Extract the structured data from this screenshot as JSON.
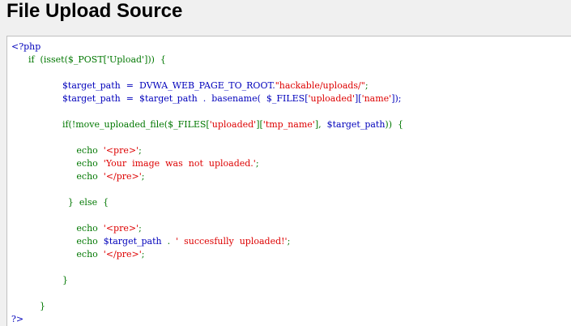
{
  "page": {
    "title": "File Upload Source"
  },
  "source": {
    "lines": [
      [
        {
          "t": "<?php",
          "c": "tag"
        }
      ],
      [
        {
          "t": "      if  (isset($_POST['Upload']))  {",
          "c": "kw"
        }
      ],
      [
        {
          "t": "",
          "c": "kw"
        }
      ],
      [
        {
          "t": "                  $target_path  =  DVWA_WEB_PAGE_TO_ROOT.",
          "c": "var"
        },
        {
          "t": "\"hackable/uploads/\"",
          "c": "str"
        },
        {
          "t": ";",
          "c": "kw"
        }
      ],
      [
        {
          "t": "                  $target_path  =  $target_path  .  basename(  $_FILES[",
          "c": "var"
        },
        {
          "t": "'uploaded'",
          "c": "str"
        },
        {
          "t": "][",
          "c": "var"
        },
        {
          "t": "'name'",
          "c": "str"
        },
        {
          "t": "]);",
          "c": "var"
        }
      ],
      [
        {
          "t": "",
          "c": "kw"
        }
      ],
      [
        {
          "t": "                  if(!move_uploaded_file($_FILES[",
          "c": "kw"
        },
        {
          "t": "'uploaded'",
          "c": "str"
        },
        {
          "t": "][",
          "c": "kw"
        },
        {
          "t": "'tmp_name'",
          "c": "str"
        },
        {
          "t": "],  ",
          "c": "kw"
        },
        {
          "t": "$target_path",
          "c": "var"
        },
        {
          "t": "))  {",
          "c": "kw"
        }
      ],
      [
        {
          "t": "",
          "c": "kw"
        }
      ],
      [
        {
          "t": "                       echo  ",
          "c": "kw"
        },
        {
          "t": "'<pre>'",
          "c": "str"
        },
        {
          "t": ";",
          "c": "kw"
        }
      ],
      [
        {
          "t": "                       echo  ",
          "c": "kw"
        },
        {
          "t": "'Your  image  was  not  uploaded.'",
          "c": "str"
        },
        {
          "t": ";",
          "c": "kw"
        }
      ],
      [
        {
          "t": "                       echo  ",
          "c": "kw"
        },
        {
          "t": "'</pre>'",
          "c": "str"
        },
        {
          "t": ";",
          "c": "kw"
        }
      ],
      [
        {
          "t": "",
          "c": "kw"
        }
      ],
      [
        {
          "t": "                    }  else  {",
          "c": "kw"
        }
      ],
      [
        {
          "t": "",
          "c": "kw"
        }
      ],
      [
        {
          "t": "                       echo  ",
          "c": "kw"
        },
        {
          "t": "'<pre>'",
          "c": "str"
        },
        {
          "t": ";",
          "c": "kw"
        }
      ],
      [
        {
          "t": "                       echo  ",
          "c": "kw"
        },
        {
          "t": "$target_path",
          "c": "var"
        },
        {
          "t": "  .  ",
          "c": "kw"
        },
        {
          "t": "'  succesfully  uploaded!'",
          "c": "str"
        },
        {
          "t": ";",
          "c": "kw"
        }
      ],
      [
        {
          "t": "                       echo  ",
          "c": "kw"
        },
        {
          "t": "'</pre>'",
          "c": "str"
        },
        {
          "t": ";",
          "c": "kw"
        }
      ],
      [
        {
          "t": "",
          "c": "kw"
        }
      ],
      [
        {
          "t": "                  }",
          "c": "kw"
        }
      ],
      [
        {
          "t": "",
          "c": "kw"
        }
      ],
      [
        {
          "t": "          }",
          "c": "kw"
        }
      ],
      [
        {
          "t": "?>",
          "c": "tag"
        }
      ]
    ]
  },
  "colors": {
    "keyword": "#007700",
    "variable": "#0000bb",
    "string": "#dd0000",
    "background": "#f0f0f0",
    "code_background": "#ffffff"
  }
}
